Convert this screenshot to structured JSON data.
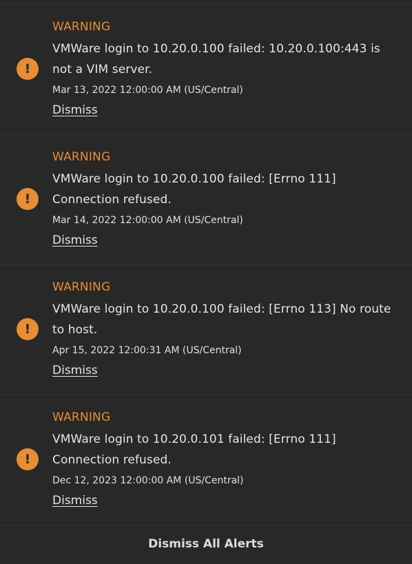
{
  "alerts": [
    {
      "level": "WARNING",
      "message": "VMWare login to 10.20.0.100 failed: 10.20.0.100:443 is not a VIM server.",
      "datetime": "Mar 13, 2022 12:00:00 AM (US/Central)",
      "dismiss_label": "Dismiss",
      "icon": "!"
    },
    {
      "level": "WARNING",
      "message": "VMWare login to 10.20.0.100 failed: [Errno 111] Connection refused.",
      "datetime": "Mar 14, 2022 12:00:00 AM (US/Central)",
      "dismiss_label": "Dismiss",
      "icon": "!"
    },
    {
      "level": "WARNING",
      "message": "VMWare login to 10.20.0.100 failed: [Errno 113] No route to host.",
      "datetime": "Apr 15, 2022 12:00:31 AM (US/Central)",
      "dismiss_label": "Dismiss",
      "icon": "!"
    },
    {
      "level": "WARNING",
      "message": "VMWare login to 10.20.0.101 failed: [Errno 111] Connection refused.",
      "datetime": "Dec 12, 2023 12:00:00 AM (US/Central)",
      "dismiss_label": "Dismiss",
      "icon": "!"
    }
  ],
  "footer": {
    "dismiss_all_label": "Dismiss All Alerts"
  },
  "colors": {
    "background": "#282828",
    "warning_accent": "#e68d36",
    "divider": "#333333",
    "text": "#e6e6e6"
  }
}
